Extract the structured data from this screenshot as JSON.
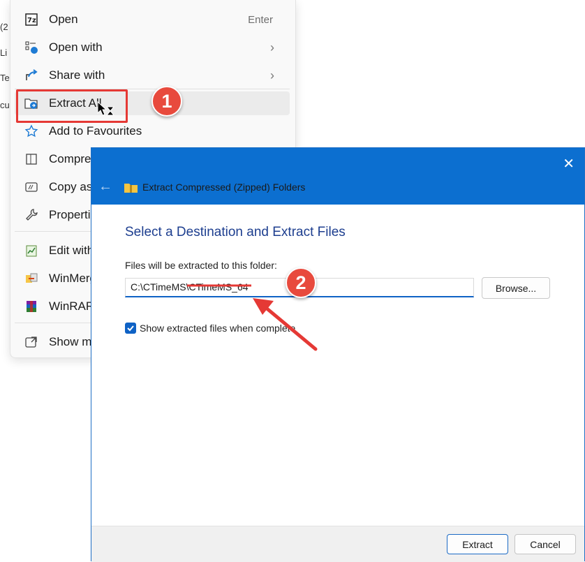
{
  "background": {
    "fragments": [
      "(2",
      "Li",
      "Te",
      "cu"
    ]
  },
  "context_menu": {
    "items": [
      {
        "label": "Open",
        "shortcut": "Enter",
        "icon": "7zip-icon"
      },
      {
        "label": "Open with",
        "icon": "open-with-icon",
        "chevron": "›"
      },
      {
        "label": "Share with",
        "icon": "share-icon",
        "chevron": "›"
      },
      {
        "label": "Extract All",
        "icon": "extract-folder-icon"
      },
      {
        "label": "Add to Favourites",
        "icon": "star-icon"
      },
      {
        "label": "Compre",
        "icon": "compress-icon"
      },
      {
        "label": "Copy as",
        "icon": "copy-path-icon"
      },
      {
        "label": "Properti",
        "icon": "wrench-icon"
      },
      {
        "label": "Edit with",
        "icon": "notepad-icon"
      },
      {
        "label": "WinMerg",
        "icon": "winmerge-icon"
      },
      {
        "label": "WinRAR",
        "icon": "winrar-icon"
      },
      {
        "label": "Show m",
        "icon": "show-more-icon"
      }
    ]
  },
  "annotations": {
    "badge1": "1",
    "badge2": "2"
  },
  "dialog": {
    "title": "Extract Compressed (Zipped) Folders",
    "close_glyph": "✕",
    "back_glyph": "←",
    "heading": "Select a Destination and Extract Files",
    "folder_label": "Files will be extracted to this folder:",
    "path_value": "C:\\CTimeMS\\CTimeMS_64",
    "browse_label": "Browse...",
    "checkbox_label": "Show extracted files when complete",
    "checkbox_checked": true,
    "extract_label": "Extract",
    "cancel_label": "Cancel"
  },
  "colors": {
    "accent": "#0c6fd0",
    "highlight": "#e53935"
  }
}
